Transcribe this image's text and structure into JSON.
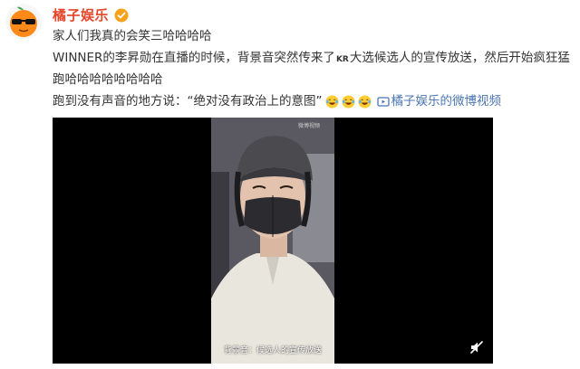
{
  "post": {
    "username": "橘子娱乐",
    "line1": "家人们我真的会笑三哈哈哈哈",
    "line2_a": "WINNER的李昇勋在直播的时候，背景音突然传来了",
    "line2_kr": "KR",
    "line2_b": "大选候选人的宣传放送，然后开始疯狂猛",
    "line3": "跑哈哈哈哈哈哈哈哈",
    "line4": "跑到没有声音的地方说：“绝对没有政治上的意图”",
    "video_link_label": "橘子娱乐的微博视频"
  },
  "video": {
    "subtitle": "背景音：候选人的宣传放送",
    "watermark": "微博视频"
  },
  "icons": {
    "avatar": "orange-with-sunglasses-icon",
    "verified": "verified-badge-icon",
    "emoji": "laughing-tears-emoji",
    "video_link": "video-link-icon",
    "mute": "mute-icon"
  },
  "colors": {
    "username": "#e6462a",
    "link": "#4b76b2",
    "verified": "#f7a21b"
  }
}
